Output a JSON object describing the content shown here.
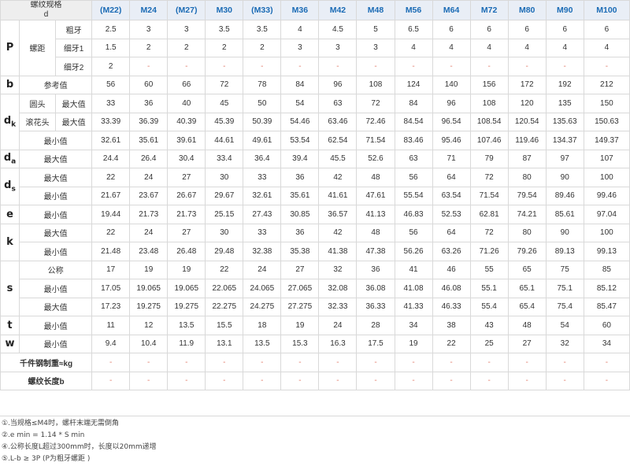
{
  "corner": {
    "line1": "螺纹规格",
    "line2": "d"
  },
  "sizes": [
    "(M22)",
    "M24",
    "(M27)",
    "M30",
    "(M33)",
    "M36",
    "M42",
    "M48",
    "M56",
    "M64",
    "M72",
    "M80",
    "M90",
    "M100"
  ],
  "labels": {
    "P": "P",
    "luoju": "螺距",
    "coarse": "粗牙",
    "fine1": "细牙1",
    "fine2": "细牙2",
    "b": "b",
    "reference": "参考值",
    "dk": "d",
    "dk_sub": "k",
    "round_head": "圆头",
    "knurled_head": "滚花头",
    "max": "最大值",
    "min": "最小值",
    "da": "d",
    "da_sub": "a",
    "ds": "d",
    "ds_sub": "s",
    "e": "e",
    "k": "k",
    "s": "s",
    "nominal": "公称",
    "t": "t",
    "w": "w",
    "weight": "千件钢制重≈kg",
    "thread_len": "螺纹长度b"
  },
  "rows": {
    "p_coarse": [
      "2.5",
      "3",
      "3",
      "3.5",
      "3.5",
      "4",
      "4.5",
      "5",
      "6.5",
      "6",
      "6",
      "6",
      "6",
      "6"
    ],
    "p_fine1": [
      "1.5",
      "2",
      "2",
      "2",
      "2",
      "3",
      "3",
      "3",
      "4",
      "4",
      "4",
      "4",
      "4",
      "4"
    ],
    "p_fine2": [
      "2",
      "-",
      "-",
      "-",
      "-",
      "-",
      "-",
      "-",
      "-",
      "-",
      "-",
      "-",
      "-",
      "-"
    ],
    "b_ref": [
      "56",
      "60",
      "66",
      "72",
      "78",
      "84",
      "96",
      "108",
      "124",
      "140",
      "156",
      "172",
      "192",
      "212"
    ],
    "dk_round_max": [
      "33",
      "36",
      "40",
      "45",
      "50",
      "54",
      "63",
      "72",
      "84",
      "96",
      "108",
      "120",
      "135",
      "150"
    ],
    "dk_knurl_max": [
      "33.39",
      "36.39",
      "40.39",
      "45.39",
      "50.39",
      "54.46",
      "63.46",
      "72.46",
      "84.54",
      "96.54",
      "108.54",
      "120.54",
      "135.63",
      "150.63"
    ],
    "dk_min": [
      "32.61",
      "35.61",
      "39.61",
      "44.61",
      "49.61",
      "53.54",
      "62.54",
      "71.54",
      "83.46",
      "95.46",
      "107.46",
      "119.46",
      "134.37",
      "149.37"
    ],
    "da_max": [
      "24.4",
      "26.4",
      "30.4",
      "33.4",
      "36.4",
      "39.4",
      "45.5",
      "52.6",
      "63",
      "71",
      "79",
      "87",
      "97",
      "107"
    ],
    "ds_max": [
      "22",
      "24",
      "27",
      "30",
      "33",
      "36",
      "42",
      "48",
      "56",
      "64",
      "72",
      "80",
      "90",
      "100"
    ],
    "ds_min": [
      "21.67",
      "23.67",
      "26.67",
      "29.67",
      "32.61",
      "35.61",
      "41.61",
      "47.61",
      "55.54",
      "63.54",
      "71.54",
      "79.54",
      "89.46",
      "99.46"
    ],
    "e_min": [
      "19.44",
      "21.73",
      "21.73",
      "25.15",
      "27.43",
      "30.85",
      "36.57",
      "41.13",
      "46.83",
      "52.53",
      "62.81",
      "74.21",
      "85.61",
      "97.04"
    ],
    "k_max": [
      "22",
      "24",
      "27",
      "30",
      "33",
      "36",
      "42",
      "48",
      "56",
      "64",
      "72",
      "80",
      "90",
      "100"
    ],
    "k_min": [
      "21.48",
      "23.48",
      "26.48",
      "29.48",
      "32.38",
      "35.38",
      "41.38",
      "47.38",
      "56.26",
      "63.26",
      "71.26",
      "79.26",
      "89.13",
      "99.13"
    ],
    "s_nom": [
      "17",
      "19",
      "19",
      "22",
      "24",
      "27",
      "32",
      "36",
      "41",
      "46",
      "55",
      "65",
      "75",
      "85"
    ],
    "s_min": [
      "17.05",
      "19.065",
      "19.065",
      "22.065",
      "24.065",
      "27.065",
      "32.08",
      "36.08",
      "41.08",
      "46.08",
      "55.1",
      "65.1",
      "75.1",
      "85.12"
    ],
    "s_max": [
      "17.23",
      "19.275",
      "19.275",
      "22.275",
      "24.275",
      "27.275",
      "32.33",
      "36.33",
      "41.33",
      "46.33",
      "55.4",
      "65.4",
      "75.4",
      "85.47"
    ],
    "t_min": [
      "11",
      "12",
      "13.5",
      "15.5",
      "18",
      "19",
      "24",
      "28",
      "34",
      "38",
      "43",
      "48",
      "54",
      "60"
    ],
    "w_min": [
      "9.4",
      "10.4",
      "11.9",
      "13.1",
      "13.5",
      "15.3",
      "16.3",
      "17.5",
      "19",
      "22",
      "25",
      "27",
      "32",
      "34"
    ],
    "weight": [
      "-",
      "-",
      "-",
      "-",
      "-",
      "-",
      "-",
      "-",
      "-",
      "-",
      "-",
      "-",
      "-",
      "-"
    ],
    "thread_len": [
      "-",
      "-",
      "-",
      "-",
      "-",
      "-",
      "-",
      "-",
      "-",
      "-",
      "-",
      "-",
      "-",
      "-"
    ]
  },
  "notes": [
    "①.当规格≤M4时，螺杆末端无需倒角",
    "②.e min = 1.14 * S min",
    "④.公称长度L超过300mm时，长度以20mm递增",
    "⑤.L-b ≥ 3P (P为粗牙螺距 )"
  ],
  "colors": {
    "size_text": "#1b6bb5",
    "header_bg": "#e9eef6",
    "border": "#d9d9d9",
    "dash": "#e07b6a"
  }
}
